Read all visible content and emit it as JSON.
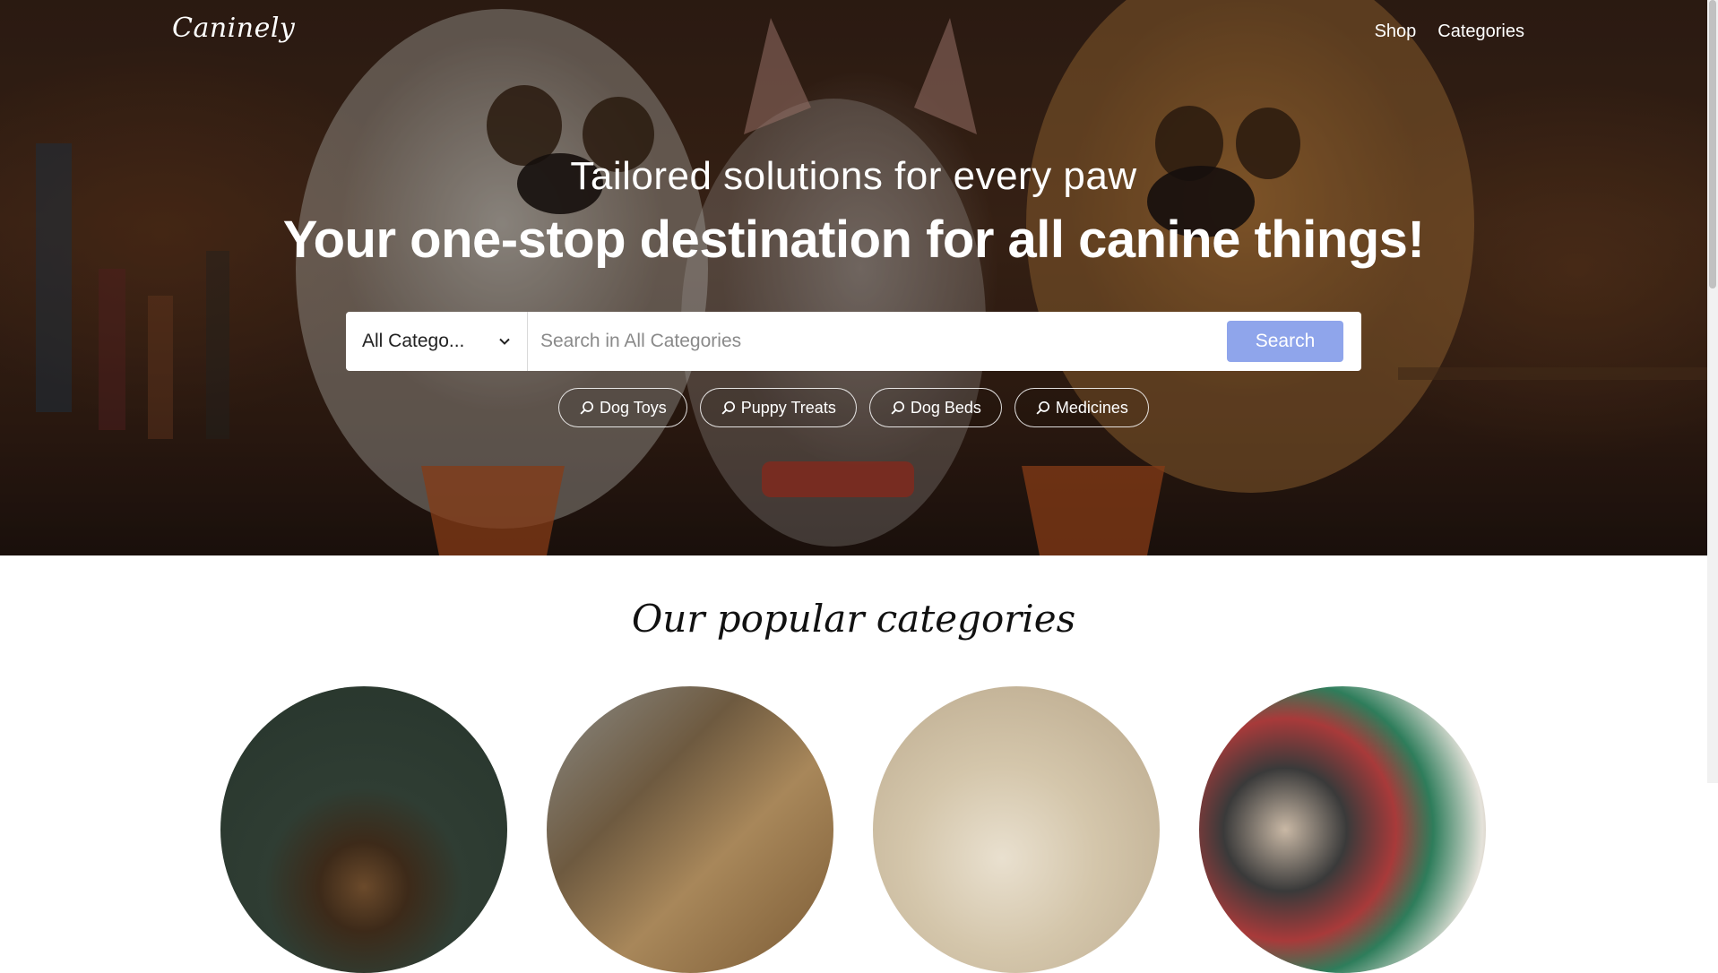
{
  "brand": {
    "name": "Caninely"
  },
  "nav": {
    "items": [
      {
        "label": "Shop"
      },
      {
        "label": "Categories"
      }
    ]
  },
  "hero": {
    "tagline": "Tailored solutions for every paw",
    "headline": "Your one-stop destination for all canine things!"
  },
  "search": {
    "category_selected": "All Catego...",
    "placeholder": "Search in All Categories",
    "button_label": "Search",
    "button_color": "#8fa5eb"
  },
  "quick_searches": [
    {
      "label": "Dog Toys",
      "icon": "search-icon"
    },
    {
      "label": "Puppy Treats",
      "icon": "search-icon"
    },
    {
      "label": "Dog Beds",
      "icon": "search-icon"
    },
    {
      "label": "Medicines",
      "icon": "search-icon"
    }
  ],
  "popular": {
    "title": "Our popular categories"
  }
}
